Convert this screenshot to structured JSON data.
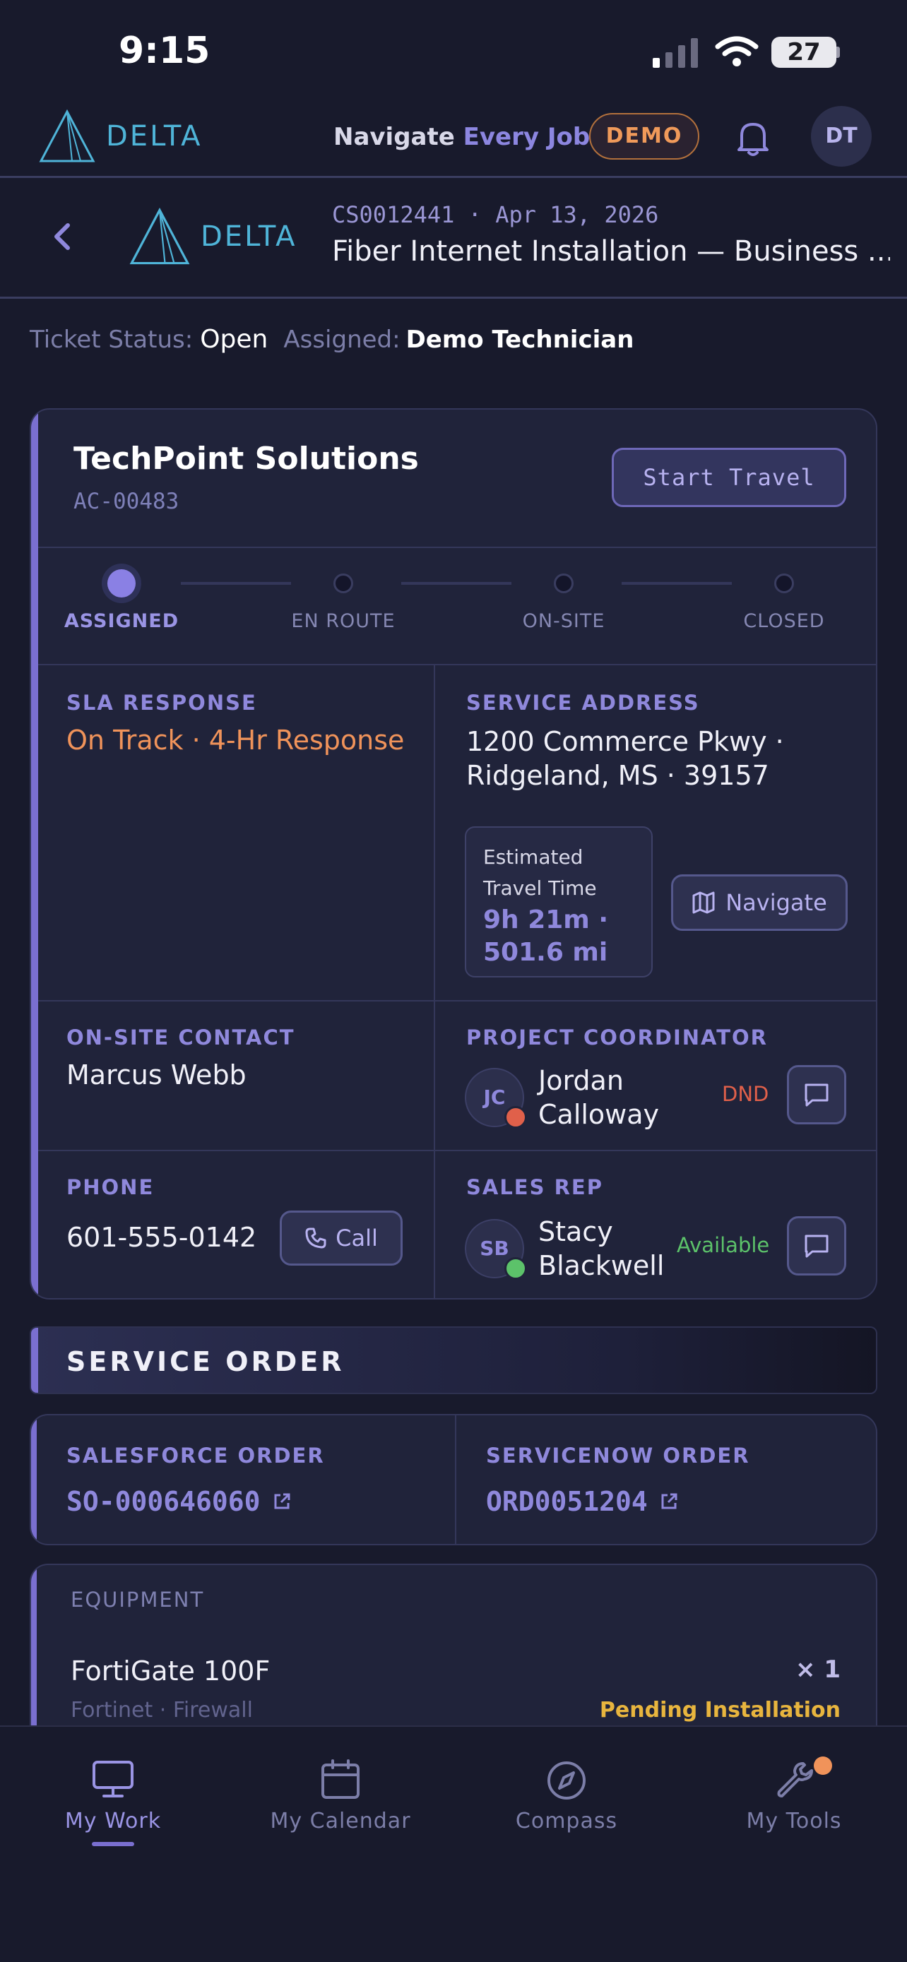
{
  "status_bar": {
    "time": "9:15",
    "battery": "27"
  },
  "app_bar": {
    "brand": "DELTA",
    "tagline_part1": "Navigate",
    "tagline_part2": "Every Job",
    "demo_badge": "DEMO",
    "user_initials": "DT"
  },
  "ticket": {
    "brand": "DELTA",
    "id_line": "CS0012441 · Apr 13, 2026",
    "title": "Fiber Internet Installation — Business ..."
  },
  "status_line": {
    "status_label": "Ticket Status:",
    "status_value": "Open",
    "assigned_label": "Assigned:",
    "assigned_value": "Demo Technician"
  },
  "job_card": {
    "company": "TechPoint Solutions",
    "account": "AC-00483",
    "start_travel": "Start Travel",
    "steps": [
      "ASSIGNED",
      "EN ROUTE",
      "ON-SITE",
      "CLOSED"
    ],
    "active_step": 0,
    "sla_label": "SLA RESPONSE",
    "sla_value": "On Track · 4-Hr Response",
    "address_label": "SERVICE ADDRESS",
    "address_line1": "1200 Commerce Pkwy ·",
    "address_line2": "Ridgeland, MS · 39157",
    "eta_label_1": "Estimated",
    "eta_label_2": "Travel Time",
    "eta_value_1": "9h 21m ·",
    "eta_value_2": "501.6 mi",
    "navigate": "Navigate",
    "onsite_label": "ON-SITE CONTACT",
    "onsite_name": "Marcus Webb",
    "coordinator_label": "PROJECT COORDINATOR",
    "coordinator_initials": "JC",
    "coordinator_first": "Jordan",
    "coordinator_last": "Calloway",
    "coordinator_status": "DND",
    "phone_label": "PHONE",
    "phone_value": "601-555-0142",
    "call": "Call",
    "sales_label": "SALES REP",
    "sales_initials": "SB",
    "sales_first": "Stacy",
    "sales_last": "Blackwell",
    "sales_status": "Available"
  },
  "service_order": {
    "title": "SERVICE ORDER",
    "salesforce_label": "SALESFORCE ORDER",
    "salesforce_value": "SO-000646060",
    "servicenow_label": "SERVICENOW ORDER",
    "servicenow_value": "ORD0051204"
  },
  "equipment": {
    "label": "EQUIPMENT",
    "items": [
      {
        "name": "FortiGate 100F",
        "qty": "× 1",
        "sub": "Fortinet · Firewall",
        "status": "Pending Installation"
      }
    ]
  },
  "tabs": [
    {
      "label": "My Work",
      "icon": "monitor-icon"
    },
    {
      "label": "My Calendar",
      "icon": "calendar-icon"
    },
    {
      "label": "Compass",
      "icon": "compass-icon"
    },
    {
      "label": "My Tools",
      "icon": "wrench-icon"
    }
  ],
  "colors": {
    "accent": "#7a6fd0",
    "sla_orange": "#f0935a",
    "dnd_red": "#e0604a",
    "available_green": "#5cc26a",
    "pending_yellow": "#e8b53e"
  }
}
